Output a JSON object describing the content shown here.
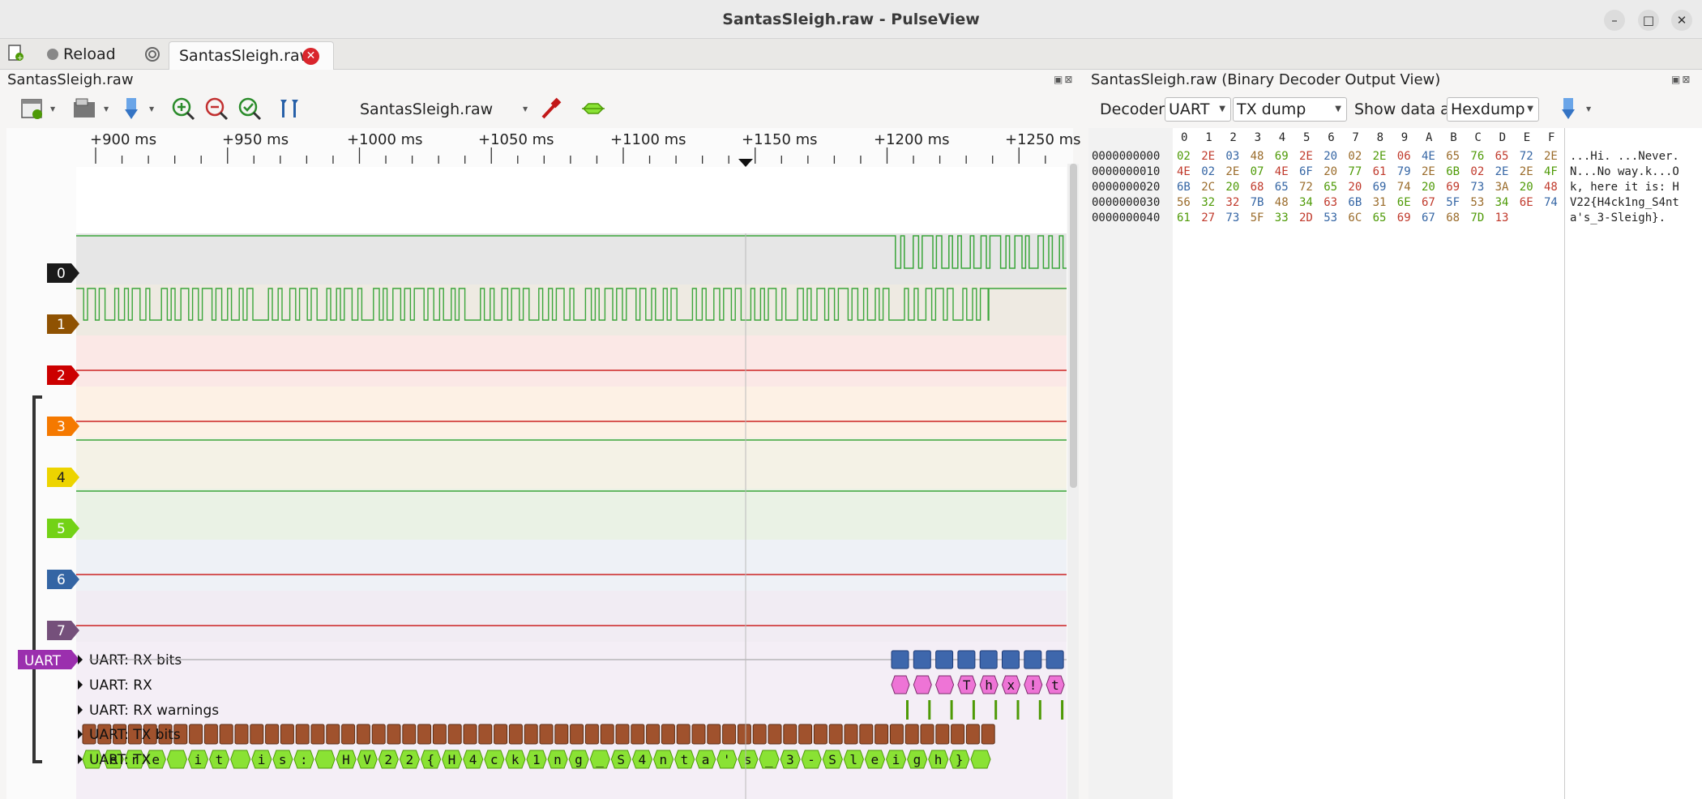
{
  "window": {
    "title": "SantasSleigh.raw - PulseView"
  },
  "tabstrip": {
    "reload_label": "Reload",
    "tab_label": "SantasSleigh.raw"
  },
  "left_panel": {
    "title": "SantasSleigh.raw",
    "device_select": "SantasSleigh.raw"
  },
  "ruler": {
    "labels": [
      "+900 ms",
      "+950 ms",
      "+1000 ms",
      "+1050 ms",
      "+1100 ms",
      "+1150 ms",
      "+1200 ms",
      "+1250 ms"
    ]
  },
  "channels": [
    {
      "label": "0",
      "color": "#1a1a1a"
    },
    {
      "label": "1",
      "color": "#8f5202"
    },
    {
      "label": "2",
      "color": "#cc0000"
    },
    {
      "label": "3",
      "color": "#f57900"
    },
    {
      "label": "4",
      "color": "#edd400"
    },
    {
      "label": "5",
      "color": "#73d216"
    },
    {
      "label": "6",
      "color": "#3465a4"
    },
    {
      "label": "7",
      "color": "#75507b"
    }
  ],
  "decoder": {
    "badge": "UARТ",
    "rows": [
      "UART: RX bits",
      "UART: RX",
      "UART: RX warnings",
      "UART: TX bits",
      "UART: TX"
    ],
    "rx_chars": [
      "",
      "",
      "",
      "T",
      "h",
      "x",
      "!",
      "t"
    ],
    "tx_chars": [
      "",
      "e",
      "r",
      "e",
      "",
      "i",
      "t",
      "",
      "i",
      "s",
      ":",
      "",
      "H",
      "V",
      "2",
      "2",
      "{",
      "H",
      "4",
      "c",
      "k",
      "1",
      "n",
      "g",
      "_",
      "S",
      "4",
      "n",
      "t",
      "a",
      "'",
      "s",
      "_",
      "3",
      "-",
      "S",
      "l",
      "e",
      "i",
      "g",
      "h",
      "}",
      ""
    ]
  },
  "right_panel": {
    "title": "SantasSleigh.raw (Binary Decoder Output View)",
    "decoder_label": "Decoder:",
    "decoder_value": "UART",
    "dump_value": "TX dump",
    "show_label": "Show data as",
    "format_value": "Hexdump",
    "hex_header": [
      "0",
      "1",
      "2",
      "3",
      "4",
      "5",
      "6",
      "7",
      "8",
      "9",
      "A",
      "B",
      "C",
      "D",
      "E",
      "F"
    ],
    "offsets": [
      "0000000000",
      "0000000010",
      "0000000020",
      "0000000030",
      "0000000040"
    ],
    "rows": [
      [
        "02",
        "2E",
        "03",
        "48",
        "69",
        "2E",
        "20",
        "02",
        "2E",
        "06",
        "4E",
        "65",
        "76",
        "65",
        "72",
        "2E"
      ],
      [
        "4E",
        "02",
        "2E",
        "07",
        "4E",
        "6F",
        "20",
        "77",
        "61",
        "79",
        "2E",
        "6B",
        "02",
        "2E",
        "2E",
        "4F"
      ],
      [
        "6B",
        "2C",
        "20",
        "68",
        "65",
        "72",
        "65",
        "20",
        "69",
        "74",
        "20",
        "69",
        "73",
        "3A",
        "20",
        "48"
      ],
      [
        "56",
        "32",
        "32",
        "7B",
        "48",
        "34",
        "63",
        "6B",
        "31",
        "6E",
        "67",
        "5F",
        "53",
        "34",
        "6E",
        "74"
      ],
      [
        "61",
        "27",
        "73",
        "5F",
        "33",
        "2D",
        "53",
        "6C",
        "65",
        "69",
        "67",
        "68",
        "7D",
        "13"
      ]
    ],
    "ascii": [
      "...Hi. ...Never.",
      "N...No way.k...O",
      "k, here it is: H",
      "V22{H4ck1ng_S4nt",
      "a's_3-Sleigh}."
    ]
  }
}
